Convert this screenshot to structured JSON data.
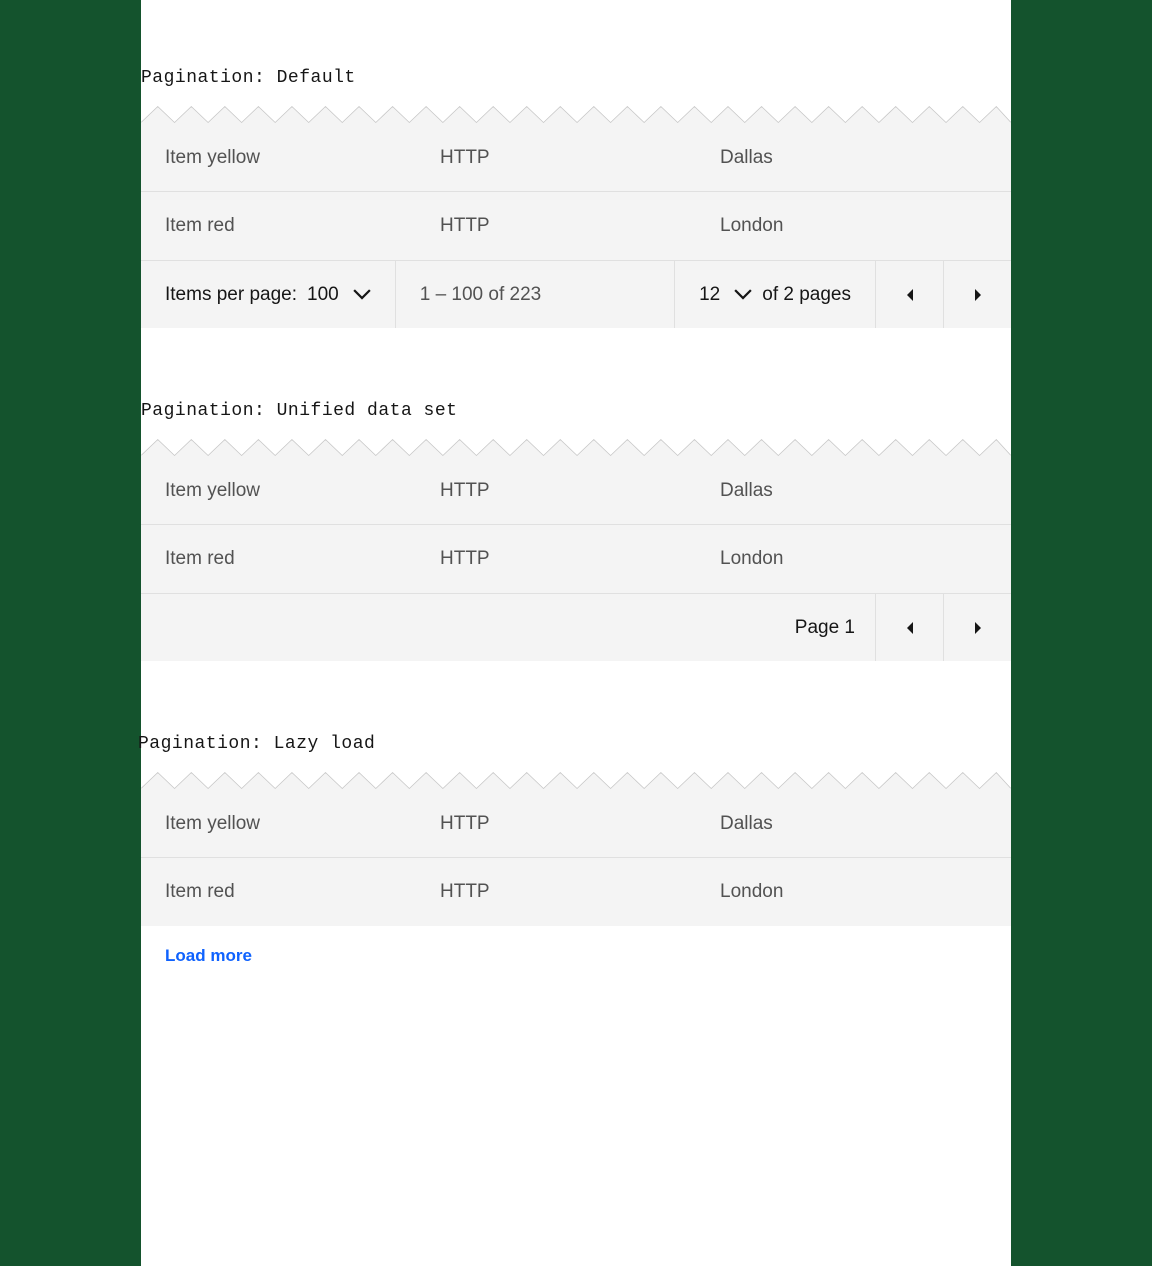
{
  "sections": [
    {
      "label": "Pagination: Default",
      "rows": [
        {
          "name": "Item yellow",
          "protocol": "HTTP",
          "location": "Dallas"
        },
        {
          "name": "Item red",
          "protocol": "HTTP",
          "location": "London"
        }
      ],
      "pagination": {
        "items_per_page_label": "Items per page:",
        "items_per_page_value": "100",
        "range_text": "1 – 100 of 223",
        "page_value": "12",
        "of_pages_text": "of 2 pages"
      }
    },
    {
      "label": "Pagination: Unified data set",
      "rows": [
        {
          "name": "Item yellow",
          "protocol": "HTTP",
          "location": "Dallas"
        },
        {
          "name": "Item red",
          "protocol": "HTTP",
          "location": "London"
        }
      ],
      "pagination": {
        "page_text": "Page 1"
      }
    },
    {
      "label": "Pagination: Lazy load",
      "rows": [
        {
          "name": "Item yellow",
          "protocol": "HTTP",
          "location": "Dallas"
        },
        {
          "name": "Item red",
          "protocol": "HTTP",
          "location": "London"
        }
      ],
      "pagination": {
        "load_more_text": "Load more"
      }
    }
  ]
}
